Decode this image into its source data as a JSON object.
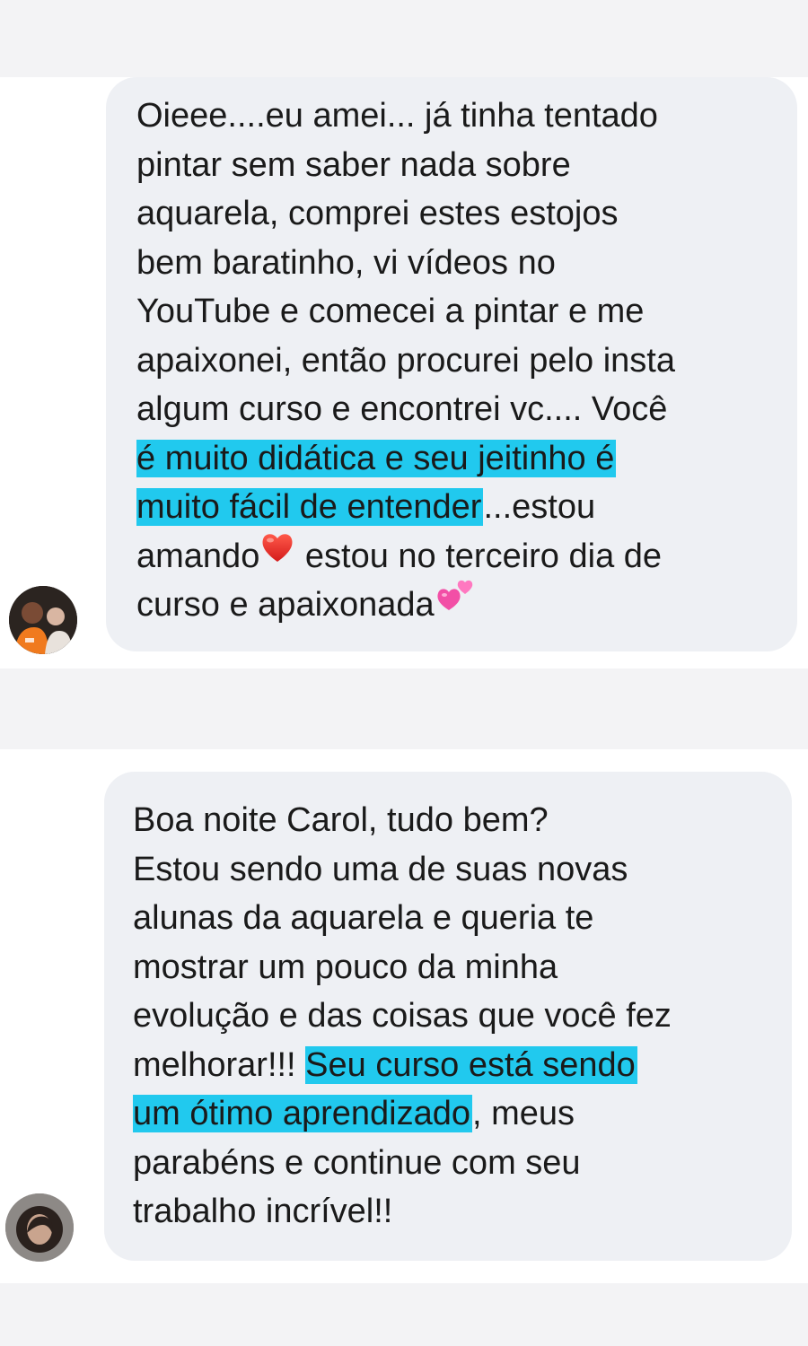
{
  "conversation": {
    "messages": [
      {
        "lines": [
          "Oieee....eu amei... já tinha tentado",
          "pintar sem saber nada sobre",
          "aquarela, comprei estes estojos",
          "bem baratinho, vi vídeos no",
          "YouTube e comecei a pintar e me",
          "apaixonei, então procurei pelo insta",
          "algum curso e encontrei vc.... Você"
        ],
        "highlight_1": "é muito didática e seu jeitinho é",
        "highlight_2": "muito fácil de entender",
        "after_highlight": "...estou",
        "amando": "amando",
        "heart": "❤️",
        "third_day": " estou no terceiro dia de",
        "last_line": "curso e apaixonada",
        "hearts_emoji": "💕"
      },
      {
        "lines": [
          "Boa noite Carol, tudo bem?",
          "Estou sendo uma de suas novas",
          "alunas da aquarela e queria te",
          "mostrar um pouco da minha",
          "evolução e das coisas que você fez"
        ],
        "before_highlight": "melhorar!!! ",
        "highlight_1": "Seu curso está sendo",
        "highlight_2": "um ótimo aprendizado",
        "after_highlight": ", meus",
        "closing_lines": [
          "parabéns e continue com seu",
          "trabalho incrível!!"
        ]
      }
    ]
  },
  "icons": {
    "avatar_1": "avatar",
    "avatar_2": "avatar",
    "heart": "red-heart-icon",
    "two_hearts": "two-hearts-icon"
  },
  "colors": {
    "highlight": "#21c9ee",
    "bubble": "#eef0f4",
    "band": "#f3f3f5"
  }
}
